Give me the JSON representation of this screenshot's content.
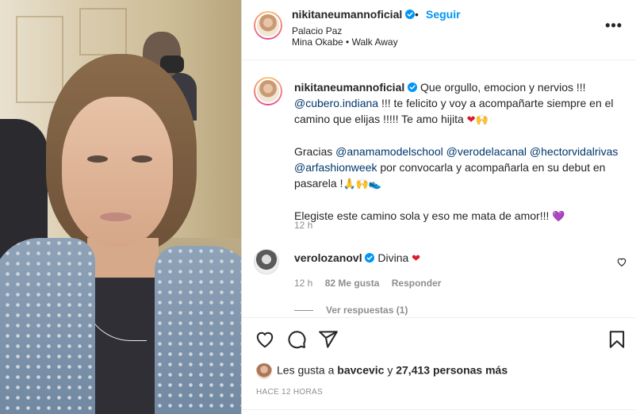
{
  "header": {
    "username": "nikitaneumannoficial",
    "separator": "•",
    "follow_label": "Seguir",
    "location": "Palacio Paz",
    "music": "Mina Okabe • Walk Away",
    "more_label": "•••"
  },
  "caption": {
    "username": "nikitaneumannoficial",
    "line1_text": "Que orgullo, emocion y nervios !!!",
    "mention1": "@cubero.indiana",
    "line2_text": " !!! te felicito y voy a acompañarte siempre en el camino que elijas !!!!! Te amo hijita ",
    "line2_emoji_heart": "❤",
    "line2_emoji_hands": "🙌",
    "thanks_prefix": "Gracias ",
    "mention2": "@anamamodelschool",
    "mention3": "@verodelacanal",
    "mention4": "@hectorvidalrivas",
    "mention5": "@arfashionweek",
    "thanks_text": " por convocarla y acompañarla en su debut en pasarela !",
    "thanks_emojis": "🙏🙌👟",
    "closing_text": "Elegiste este camino sola y eso me mata de amor!!! ",
    "closing_emoji": "💜",
    "time": "12 h"
  },
  "comment": {
    "username": "verolozanovl",
    "text": "Divina ",
    "emoji": "❤",
    "time": "12 h",
    "likes": "82 Me gusta",
    "reply_label": "Responder",
    "view_replies": "Ver respuestas (1)"
  },
  "likes": {
    "prefix": "Les gusta a ",
    "user": "bavcevic",
    "middle": " y ",
    "count": "27,413 personas más"
  },
  "posted_ago": "HACE 12 HORAS",
  "colors": {
    "link_blue": "#0095f6",
    "mention_blue": "#00376b",
    "verified_blue": "#0095f6",
    "secondary_text": "#8e8e8e"
  }
}
